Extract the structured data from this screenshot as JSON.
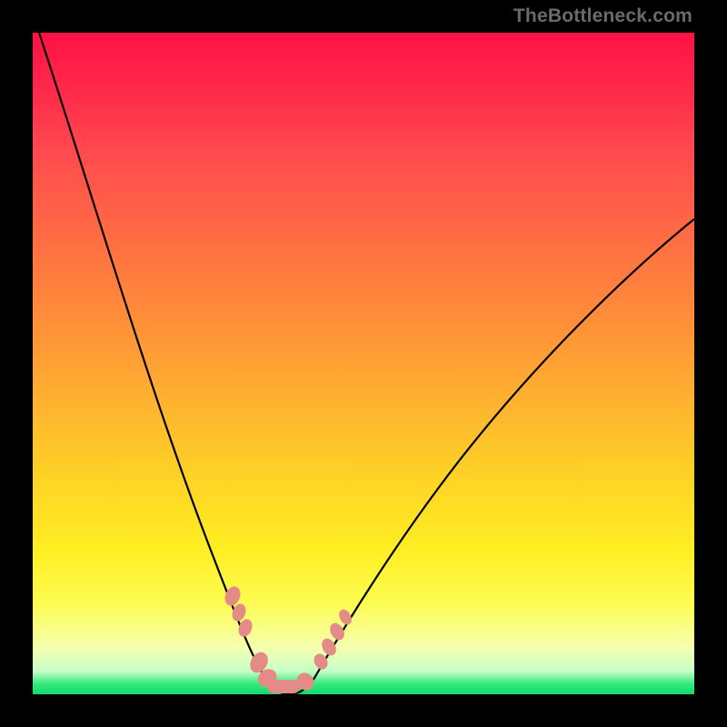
{
  "attribution": "TheBottleneck.com",
  "chart_data": {
    "type": "line",
    "title": "",
    "xlabel": "",
    "ylabel": "",
    "xlim": [
      0,
      100
    ],
    "ylim": [
      0,
      100
    ],
    "series": [
      {
        "name": "bottleneck-curve",
        "color": "#000000",
        "x": [
          1,
          5,
          10,
          15,
          20,
          25,
          28,
          30,
          32,
          34,
          36,
          38,
          40,
          45,
          50,
          55,
          60,
          65,
          70,
          75,
          80,
          85,
          90,
          95,
          100
        ],
        "y": [
          100,
          88,
          73,
          59,
          46,
          33,
          25,
          19,
          12,
          6,
          2,
          0,
          0,
          2,
          7,
          14,
          21,
          28,
          34,
          40,
          46,
          51,
          56,
          60,
          64
        ]
      }
    ],
    "annotations": [
      {
        "name": "marker-cluster-left",
        "shape": "blob",
        "color": "#e58b87",
        "approx_x": 31,
        "approx_y": 12
      },
      {
        "name": "marker-cluster-floor",
        "shape": "blob",
        "color": "#e58b87",
        "approx_x": 36,
        "approx_y": 1
      },
      {
        "name": "marker-cluster-right",
        "shape": "blob",
        "color": "#e58b87",
        "approx_x": 44,
        "approx_y": 9
      }
    ],
    "background_gradient": {
      "top": "#ff1144",
      "mid": "#ffd226",
      "bottom": "#12da6e"
    }
  }
}
